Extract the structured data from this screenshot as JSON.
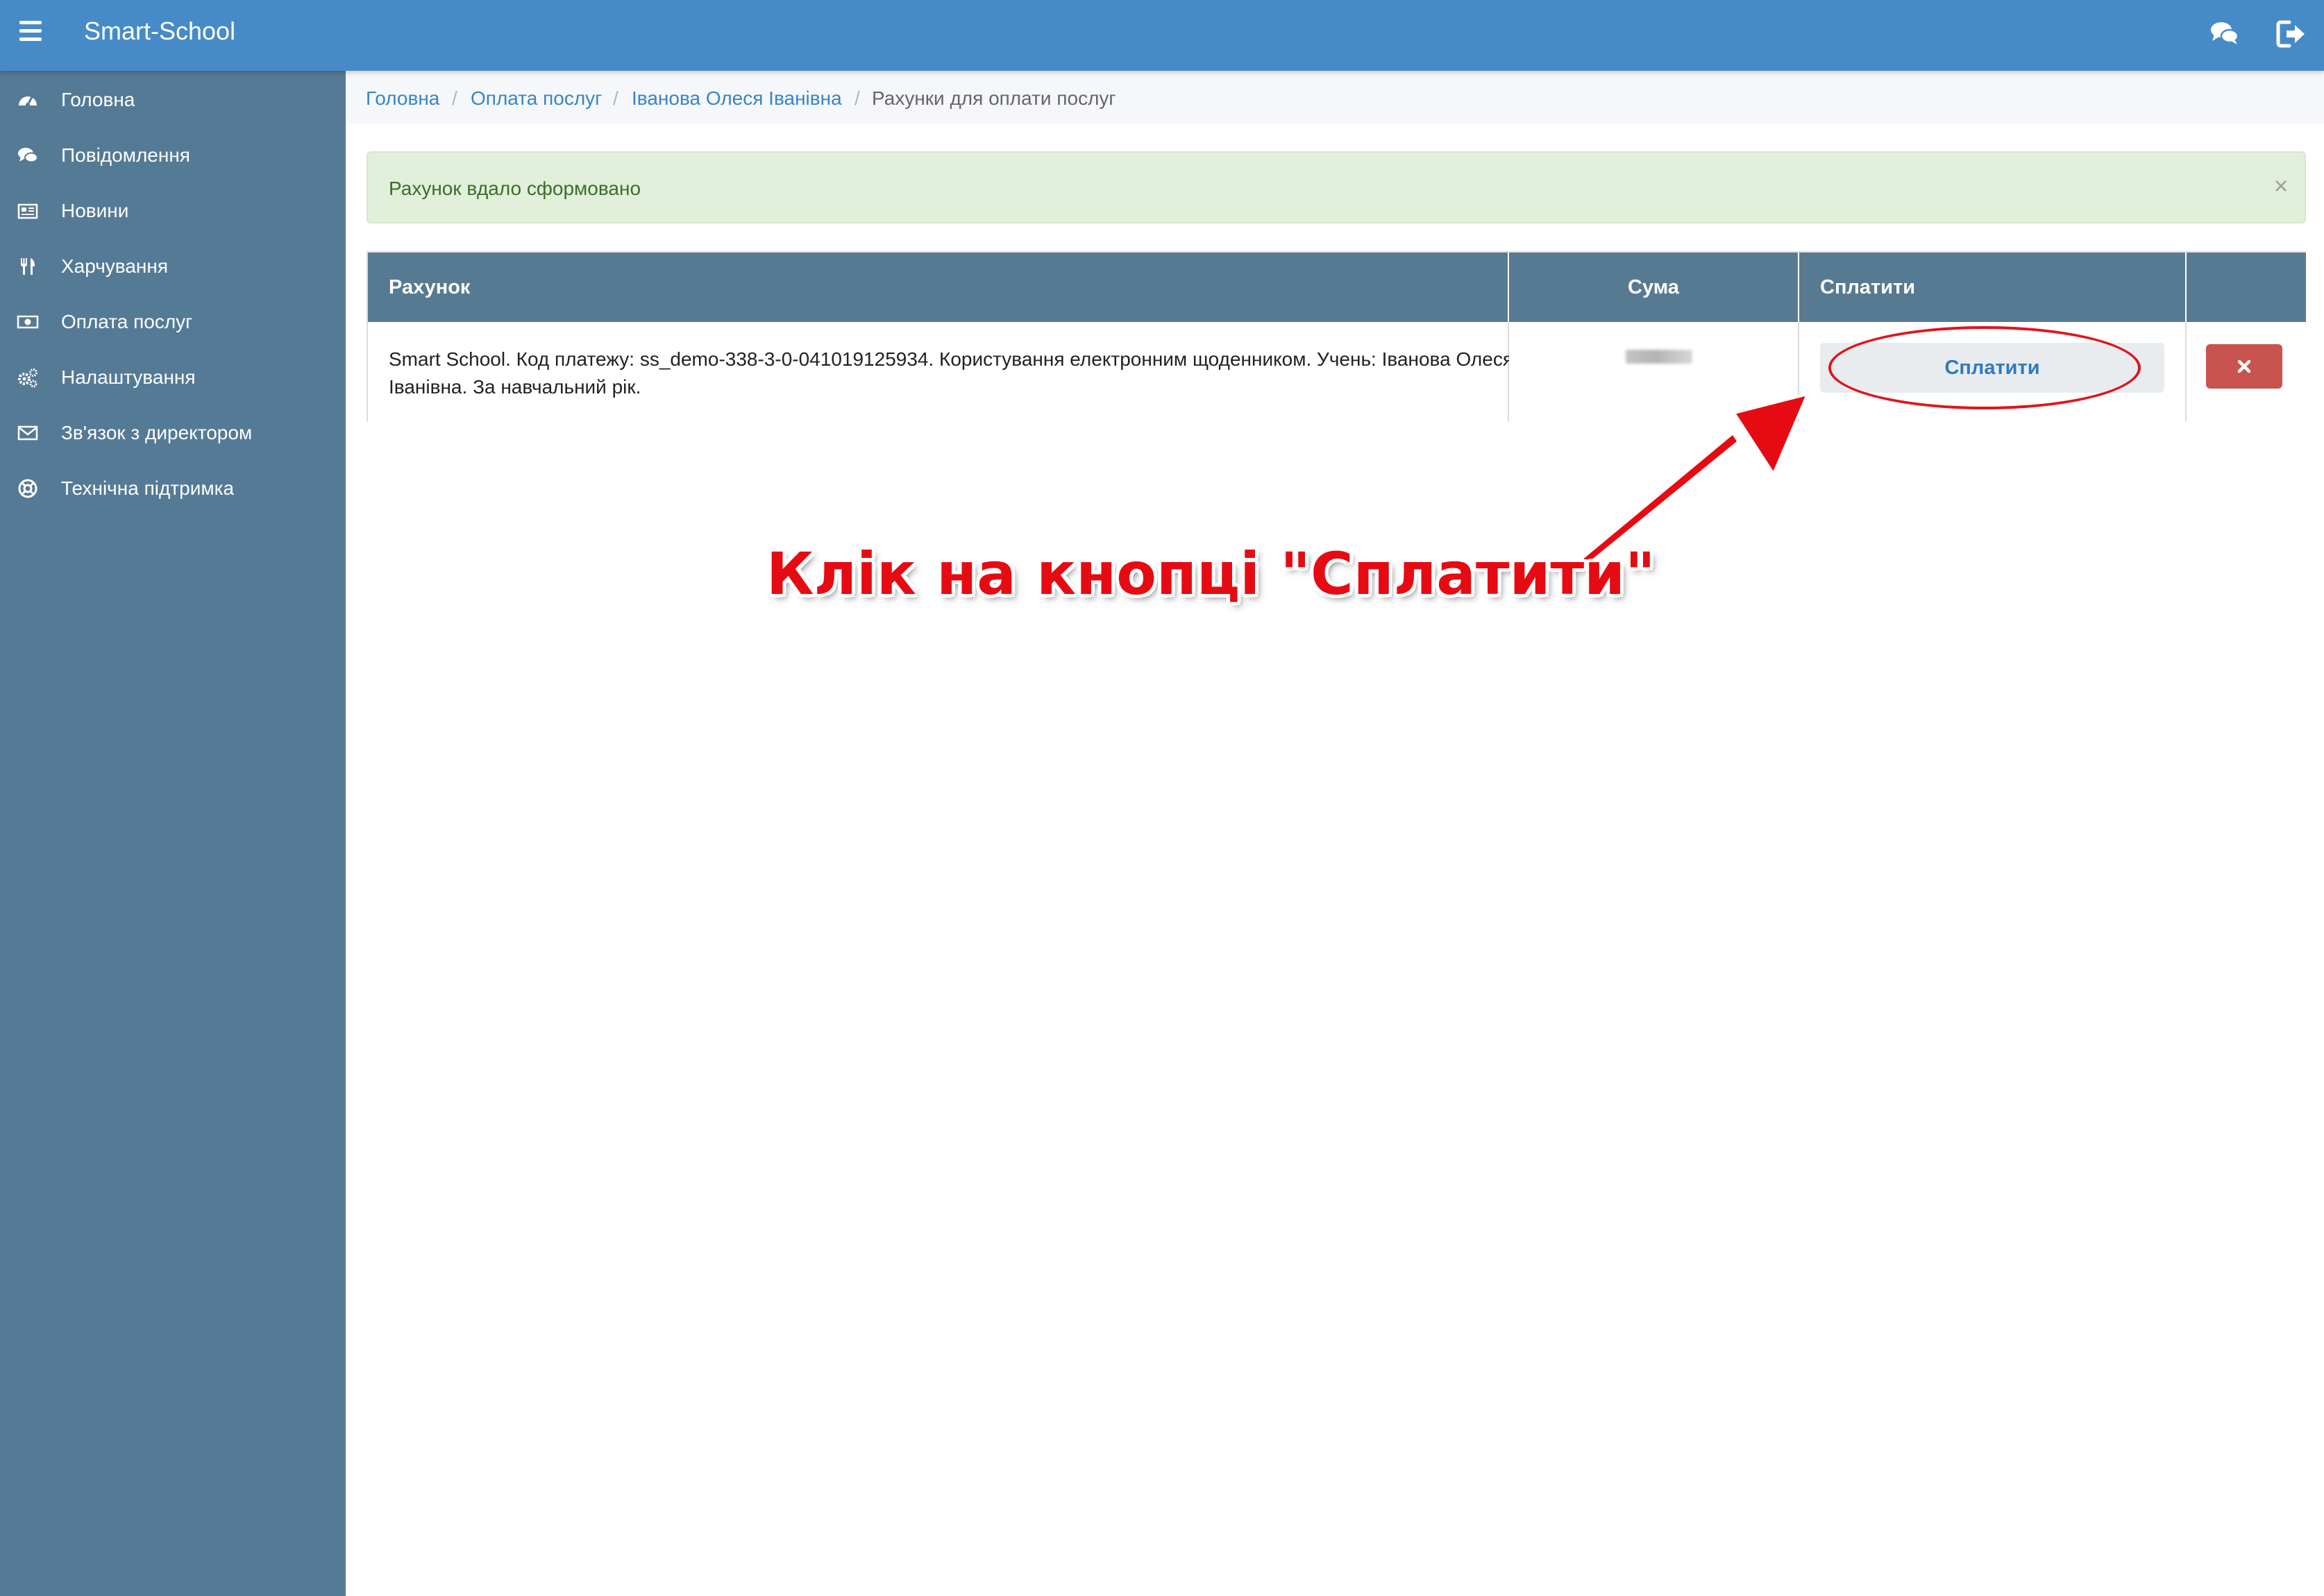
{
  "header": {
    "app_title": "Smart-School",
    "menu_icon": "hamburger-menu-icon",
    "chat_icon": "comments-icon",
    "logout_icon": "sign-out-icon",
    "background_color": "#468bc8"
  },
  "sidebar": {
    "background_color": "#557a96",
    "items": [
      {
        "label": "Головна",
        "icon": "dashboard-icon"
      },
      {
        "label": "Повідомлення",
        "icon": "comments-icon"
      },
      {
        "label": "Новини",
        "icon": "newspaper-icon"
      },
      {
        "label": "Харчування",
        "icon": "cutlery-icon"
      },
      {
        "label": "Оплата послуг",
        "icon": "money-icon"
      },
      {
        "label": "Налаштування",
        "icon": "gears-icon"
      },
      {
        "label": "Зв'язок з директором",
        "icon": "envelope-icon"
      },
      {
        "label": "Технічна підтримка",
        "icon": "life-ring-icon"
      }
    ]
  },
  "breadcrumb": {
    "items": [
      "Головна",
      "Оплата послуг",
      "Іванова Олеся Іванівна",
      "Рахунки для оплати послуг"
    ],
    "separator": "/"
  },
  "alert": {
    "message": "Рахунок вдало сформовано",
    "close_label": "×"
  },
  "table": {
    "headers": {
      "invoice": "Рахунок",
      "amount": "Сума",
      "pay": "Сплатити",
      "actions": ""
    },
    "rows": [
      {
        "description": "Smart School. Код платежу: ss_demo-338-3-0-041019125934. Користування електронним щоденником. Учень: Іванова Олеся Іванівна. За навчальний рік.",
        "amount": "",
        "pay_button": "Сплатити",
        "delete_icon": "times-icon"
      }
    ],
    "header_color": "#567a92"
  },
  "annotation": {
    "text": "Клік на кнопці \"Сплатити\"",
    "color": "#e60b12"
  }
}
